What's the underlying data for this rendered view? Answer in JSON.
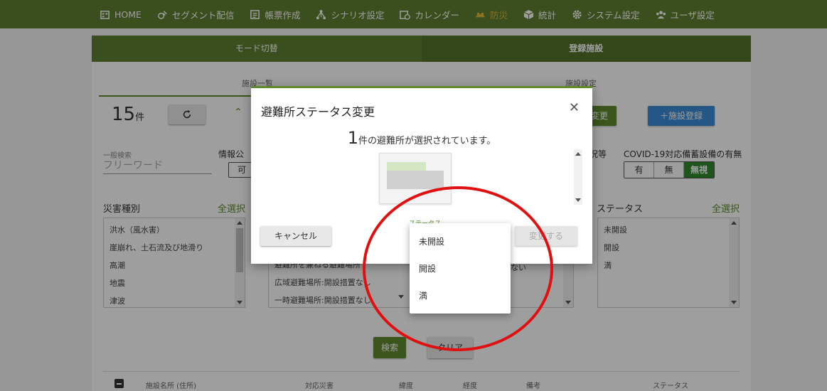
{
  "nav": {
    "items": [
      {
        "label": "HOME",
        "icon": "calendar-icon"
      },
      {
        "label": "セグメント配信",
        "icon": "broadcast-icon"
      },
      {
        "label": "帳票作成",
        "icon": "document-icon"
      },
      {
        "label": "シナリオ設定",
        "icon": "tree-icon"
      },
      {
        "label": "カレンダー",
        "icon": "calendar-clock-icon"
      },
      {
        "label": "防災",
        "icon": "hand-icon",
        "active": true
      },
      {
        "label": "統計",
        "icon": "cube-icon"
      },
      {
        "label": "システム設定",
        "icon": "gear-icon"
      },
      {
        "label": "ユーザ設定",
        "icon": "users-icon"
      }
    ],
    "bg_color": "#5f7e2f",
    "active_color": "#e3b83a"
  },
  "tabs": [
    {
      "label": "モード切替"
    },
    {
      "label": "登録施設",
      "active": true
    }
  ],
  "subtabs": {
    "list": "施設一覧",
    "settings": "施設設定"
  },
  "count": {
    "number": "15",
    "unit": "件"
  },
  "refresh_icon": "refresh-icon",
  "partial_button": "変更",
  "add_facility_button": "＋施設登録",
  "search": {
    "label": "一般検索",
    "placeholder": "フリーワード"
  },
  "info_label": "情報公",
  "info_value": "可",
  "status_etc_label": "況等",
  "covid": {
    "label": "COVID-19対応備蓄設備の有無",
    "options": [
      "有",
      "無",
      "無視"
    ],
    "selected": "無視"
  },
  "disaster": {
    "label": "災害種別",
    "select_all": "全選択",
    "items": [
      "洪水（風水害）",
      "崖崩れ、土石流及び地滑り",
      "高潮",
      "地震",
      "津波"
    ]
  },
  "shelter_types": {
    "items": [
      "避難所を兼ねる避難場所",
      "広域避難場所:開設措置なし",
      "一時避難場所:開設措置なし"
    ],
    "partial": "ない"
  },
  "status_filter": {
    "label": "ステータス",
    "select_all": "全選択",
    "items": [
      "未開設",
      "開設",
      "満"
    ]
  },
  "search_button": "検索",
  "clear_button": "クリア",
  "table_headers": [
    "施設名所 (住所)",
    "対応災害",
    "緯度",
    "経度",
    "備考",
    "ステータス"
  ],
  "modal": {
    "title": "避難所ステータス変更",
    "count": "1",
    "count_text": "件の避難所が選択されています。",
    "status_label": "ステータス",
    "cancel": "キャンセル",
    "confirm": "変更する",
    "close_icon": "close-icon"
  },
  "dropdown": {
    "options": [
      "未開設",
      "開設",
      "満"
    ]
  },
  "annotation_color": "#e01010"
}
